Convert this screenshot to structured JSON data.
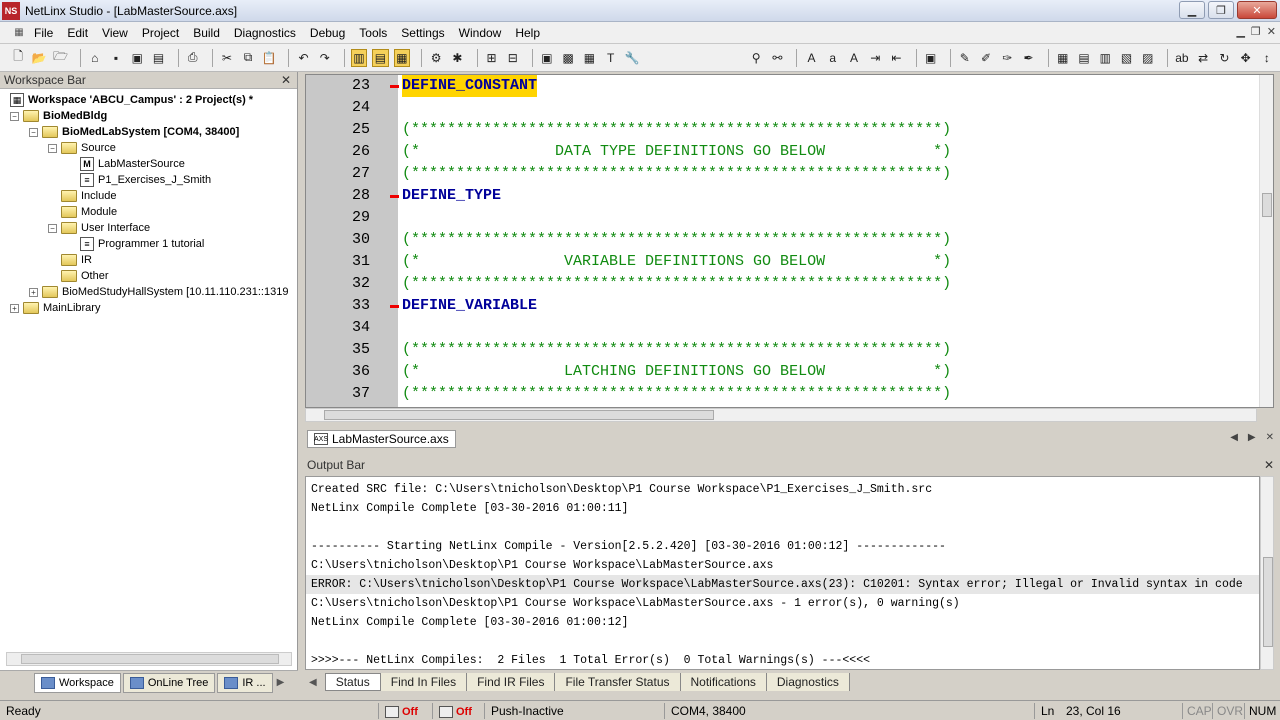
{
  "window": {
    "title": "NetLinx Studio - [LabMasterSource.axs]",
    "app_icon": "NS"
  },
  "menu": [
    "File",
    "Edit",
    "View",
    "Project",
    "Build",
    "Diagnostics",
    "Debug",
    "Tools",
    "Settings",
    "Window",
    "Help"
  ],
  "workspace": {
    "title": "Workspace Bar",
    "tree": [
      {
        "label": "Workspace 'ABCU_Campus' : 2 Project(s) *",
        "bold": true,
        "level": 0
      },
      {
        "label": "BioMedBldg",
        "bold": true,
        "level": 0
      },
      {
        "label": "BioMedLabSystem [COM4, 38400]",
        "bold": true,
        "level": 1
      },
      {
        "label": "Source",
        "level": 2
      },
      {
        "label": "LabMasterSource",
        "level": 3,
        "icon": "M"
      },
      {
        "label": "P1_Exercises_J_Smith",
        "level": 3
      },
      {
        "label": "Include",
        "level": 2
      },
      {
        "label": "Module",
        "level": 2
      },
      {
        "label": "User Interface",
        "level": 2
      },
      {
        "label": "Programmer 1 tutorial",
        "level": 3
      },
      {
        "label": "IR",
        "level": 2
      },
      {
        "label": "Other",
        "level": 2
      },
      {
        "label": "BioMedStudyHallSystem [10.11.110.231::1319",
        "level": 1
      },
      {
        "label": "MainLibrary",
        "level": 0
      }
    ],
    "tabs": [
      "Workspace",
      "OnLine Tree",
      "IR ..."
    ]
  },
  "editor": {
    "lines": [
      {
        "n": "23",
        "text": "DEFINE_CONSTANT",
        "kind": "kw",
        "marker": true,
        "selected": true
      },
      {
        "n": "24",
        "text": "",
        "kind": "none"
      },
      {
        "n": "25",
        "text": "(***********************************************************)",
        "kind": "cm"
      },
      {
        "n": "26",
        "text": "(*               DATA TYPE DEFINITIONS GO BELOW            *)",
        "kind": "cm"
      },
      {
        "n": "27",
        "text": "(***********************************************************)",
        "kind": "cm"
      },
      {
        "n": "28",
        "text": "DEFINE_TYPE",
        "kind": "kw",
        "marker": true
      },
      {
        "n": "29",
        "text": "",
        "kind": "none"
      },
      {
        "n": "30",
        "text": "(***********************************************************)",
        "kind": "cm"
      },
      {
        "n": "31",
        "text": "(*                VARIABLE DEFINITIONS GO BELOW            *)",
        "kind": "cm"
      },
      {
        "n": "32",
        "text": "(***********************************************************)",
        "kind": "cm"
      },
      {
        "n": "33",
        "text": "DEFINE_VARIABLE",
        "kind": "kw",
        "marker": true
      },
      {
        "n": "34",
        "text": "",
        "kind": "none"
      },
      {
        "n": "35",
        "text": "(***********************************************************)",
        "kind": "cm"
      },
      {
        "n": "36",
        "text": "(*                LATCHING DEFINITIONS GO BELOW            *)",
        "kind": "cm"
      },
      {
        "n": "37",
        "text": "(***********************************************************)",
        "kind": "cm"
      }
    ]
  },
  "doc_tab": "LabMasterSource.axs",
  "output": {
    "title": "Output Bar",
    "lines": [
      "Created SRC file: C:\\Users\\tnicholson\\Desktop\\P1 Course Workspace\\P1_Exercises_J_Smith.src",
      "NetLinx Compile Complete [03-30-2016 01:00:11]",
      "",
      "---------- Starting NetLinx Compile - Version[2.5.2.420] [03-30-2016 01:00:12] -------------",
      "C:\\Users\\tnicholson\\Desktop\\P1 Course Workspace\\LabMasterSource.axs",
      "ERROR: C:\\Users\\tnicholson\\Desktop\\P1 Course Workspace\\LabMasterSource.axs(23): C10201: Syntax error; Illegal or Invalid syntax in code",
      "C:\\Users\\tnicholson\\Desktop\\P1 Course Workspace\\LabMasterSource.axs - 1 error(s), 0 warning(s)",
      "NetLinx Compile Complete [03-30-2016 01:00:12]",
      "",
      ">>>>--- NetLinx Compiles:  2 Files  1 Total Error(s)  0 Total Warnings(s) ---<<<<"
    ],
    "error_line_index": 5,
    "tabs": [
      "Status",
      "Find In Files",
      "Find IR Files",
      "File Transfer Status",
      "Notifications",
      "Diagnostics"
    ]
  },
  "status": {
    "ready": "Ready",
    "off1": "Off",
    "off2": "Off",
    "push": "Push-Inactive",
    "com": "COM4, 38400",
    "ln_label": "Ln",
    "pos": "23, Col 16",
    "caps": "CAP",
    "ovr": "OVR",
    "num": "NUM"
  },
  "colors": {
    "keyword": "#00009a",
    "comment": "#118b11",
    "highlight": "#ffd400",
    "marker": "#e00000"
  }
}
